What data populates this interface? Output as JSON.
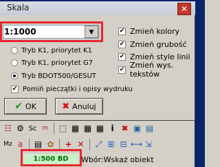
{
  "dialog": {
    "title": "Skala",
    "scale_value": "1:1000",
    "radios": [
      {
        "label": "Tryb K1, priorytet K1",
        "selected": false
      },
      {
        "label": "Tryb K1, priorytet G7",
        "selected": false
      },
      {
        "label": "Tryb BDOT500/GESUT",
        "selected": true
      }
    ],
    "omit_checkbox_label": "Pomiń pieczątki i opisy wydruku",
    "checkboxes": [
      {
        "label": "Zmień kolory",
        "checked": true
      },
      {
        "label": "Zmień grubość",
        "checked": true
      },
      {
        "label": "Zmień style linii",
        "checked": true
      },
      {
        "label": "Zmień wys. tekstów",
        "checked": true
      }
    ],
    "ok_label": "OK",
    "cancel_label": "Anuluj"
  },
  "toolbar": {
    "sc_label": "Sc",
    "mz_label": "Mz"
  },
  "statusbar": {
    "scale": "1:500 BD",
    "message": "Wbór:Wskaż obiekt"
  }
}
